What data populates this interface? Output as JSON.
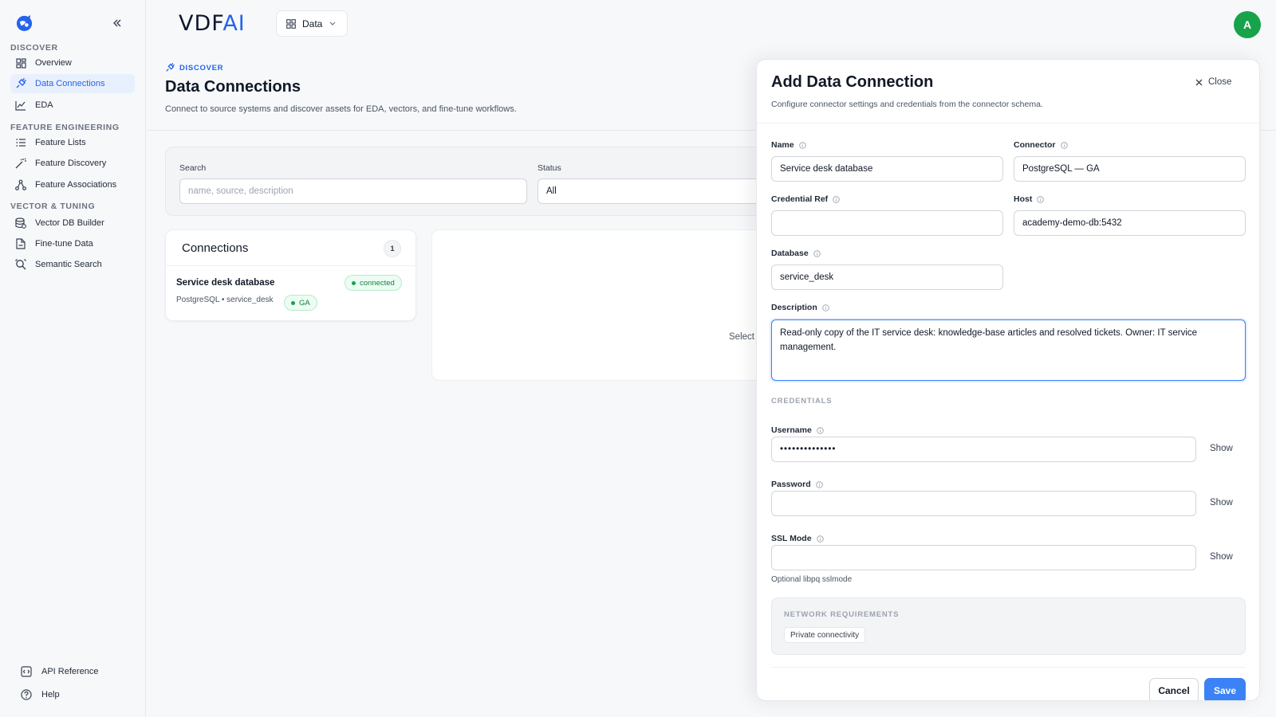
{
  "brand": {
    "text": "VDF",
    "accent": "AI"
  },
  "workspace": {
    "label": "Data"
  },
  "user": {
    "avatar_initial": "A"
  },
  "sidebar": {
    "sections": [
      {
        "label": "DISCOVER"
      },
      {
        "label": "FEATURE ENGINEERING"
      },
      {
        "label": "VECTOR & TUNING"
      }
    ],
    "items": [
      {
        "label": "Overview",
        "icon": "overview-icon"
      },
      {
        "label": "Data Connections",
        "icon": "plug-icon",
        "active": true
      },
      {
        "label": "EDA",
        "icon": "chart-icon"
      },
      {
        "label": "Feature Lists",
        "icon": "list-icon"
      },
      {
        "label": "Feature Discovery",
        "icon": "wand-icon"
      },
      {
        "label": "Feature Associations",
        "icon": "network-icon"
      },
      {
        "label": "Vector DB Builder",
        "icon": "database-icon"
      },
      {
        "label": "Fine-tune Data",
        "icon": "file-icon"
      },
      {
        "label": "Semantic Search",
        "icon": "search-icon"
      }
    ],
    "footer": [
      {
        "label": "API Reference",
        "icon": "api-icon"
      },
      {
        "label": "Help",
        "icon": "help-icon"
      }
    ]
  },
  "header": {
    "crumb": "DISCOVER",
    "title": "Data Connections",
    "subtitle": "Connect to source systems and discover assets for EDA, vectors, and fine-tune workflows."
  },
  "filters": {
    "search_label": "Search",
    "search_placeholder": "name, source, description",
    "status_label": "Status",
    "status_value": "All"
  },
  "connections": {
    "title": "Connections",
    "count": "1",
    "items": [
      {
        "name": "Service desk database",
        "meta": "PostgreSQL • service_desk",
        "status": "connected",
        "tier": "GA"
      }
    ]
  },
  "detail": {
    "hint": "Select"
  },
  "drawer": {
    "title": "Add Data Connection",
    "subtitle": "Configure connector settings and credentials from the connector schema.",
    "close_label": "Close",
    "fields": {
      "name": {
        "label": "Name",
        "value": "Service desk database"
      },
      "connector": {
        "label": "Connector",
        "value": "PostgreSQL — GA"
      },
      "credential_ref": {
        "label": "Credential Ref",
        "value": ""
      },
      "host": {
        "label": "Host",
        "value": "academy-demo-db:5432"
      },
      "database": {
        "label": "Database",
        "value": "service_desk"
      },
      "description": {
        "label": "Description",
        "value": "Read-only copy of the IT service desk: knowledge-base articles and resolved tickets. Owner: IT service management."
      }
    },
    "credentials_label": "CREDENTIALS",
    "credentials": {
      "username": {
        "label": "Username",
        "value": "••••••••••••••",
        "show_label": "Show"
      },
      "password": {
        "label": "Password",
        "value": "",
        "show_label": "Show"
      },
      "ssl_mode": {
        "label": "SSL Mode",
        "value": "",
        "show_label": "Show",
        "hint": "Optional libpq sslmode"
      }
    },
    "network": {
      "label": "NETWORK REQUIREMENTS",
      "chip": "Private connectivity"
    },
    "cancel_label": "Cancel",
    "save_label": "Save"
  }
}
